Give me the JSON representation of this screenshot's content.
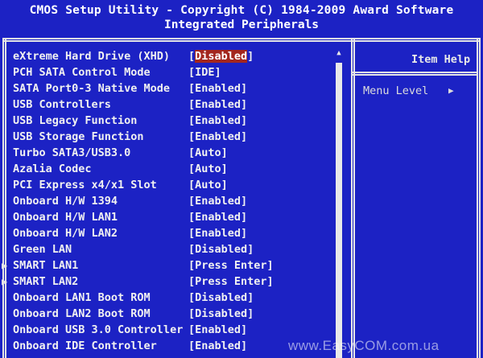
{
  "header": {
    "title": "CMOS Setup Utility - Copyright (C) 1984-2009 Award Software",
    "subtitle": "Integrated Peripherals"
  },
  "help_panel": {
    "title": "Item Help",
    "menu_level_label": "Menu Level",
    "menu_level_arrow": "▶"
  },
  "scrollbar": {
    "up_arrow": "▲"
  },
  "items": [
    {
      "label": "eXtreme Hard Drive (XHD)",
      "value_prefix": "[",
      "value": "Disabled",
      "value_suffix": "]",
      "selected": true,
      "submenu": false
    },
    {
      "label": "PCH SATA Control Mode",
      "value_prefix": "[",
      "value": "IDE",
      "value_suffix": "]",
      "selected": false,
      "submenu": false
    },
    {
      "label": "SATA Port0-3 Native Mode",
      "value_prefix": "[",
      "value": "Enabled",
      "value_suffix": "]",
      "selected": false,
      "submenu": false
    },
    {
      "label": "USB Controllers",
      "value_prefix": "[",
      "value": "Enabled",
      "value_suffix": "]",
      "selected": false,
      "submenu": false
    },
    {
      "label": "USB Legacy Function",
      "value_prefix": "[",
      "value": "Enabled",
      "value_suffix": "]",
      "selected": false,
      "submenu": false
    },
    {
      "label": "USB Storage Function",
      "value_prefix": "[",
      "value": "Enabled",
      "value_suffix": "]",
      "selected": false,
      "submenu": false
    },
    {
      "label": "Turbo SATA3/USB3.0",
      "value_prefix": "[",
      "value": "Auto",
      "value_suffix": "]",
      "selected": false,
      "submenu": false
    },
    {
      "label": "Azalia Codec",
      "value_prefix": "[",
      "value": "Auto",
      "value_suffix": "]",
      "selected": false,
      "submenu": false
    },
    {
      "label": "PCI Express x4/x1 Slot",
      "value_prefix": "[",
      "value": "Auto",
      "value_suffix": "]",
      "selected": false,
      "submenu": false
    },
    {
      "label": "Onboard H/W 1394",
      "value_prefix": "[",
      "value": "Enabled",
      "value_suffix": "]",
      "selected": false,
      "submenu": false
    },
    {
      "label": "Onboard H/W LAN1",
      "value_prefix": "[",
      "value": "Enabled",
      "value_suffix": "]",
      "selected": false,
      "submenu": false
    },
    {
      "label": "Onboard H/W LAN2",
      "value_prefix": "[",
      "value": "Enabled",
      "value_suffix": "]",
      "selected": false,
      "submenu": false
    },
    {
      "label": "Green LAN",
      "value_prefix": "[",
      "value": "Disabled",
      "value_suffix": "]",
      "selected": false,
      "submenu": false
    },
    {
      "label": "SMART LAN1",
      "value_prefix": "[",
      "value": "Press Enter",
      "value_suffix": "]",
      "selected": false,
      "submenu": true
    },
    {
      "label": "SMART LAN2",
      "value_prefix": "[",
      "value": "Press Enter",
      "value_suffix": "]",
      "selected": false,
      "submenu": true
    },
    {
      "label": "Onboard LAN1 Boot ROM",
      "value_prefix": "[",
      "value": "Disabled",
      "value_suffix": "]",
      "selected": false,
      "submenu": false
    },
    {
      "label": "Onboard LAN2 Boot ROM",
      "value_prefix": "[",
      "value": "Disabled",
      "value_suffix": "]",
      "selected": false,
      "submenu": false
    },
    {
      "label": "Onboard USB 3.0 Controller",
      "value_prefix": "[",
      "value": "Enabled",
      "value_suffix": "]",
      "selected": false,
      "submenu": false
    },
    {
      "label": "Onboard IDE Controller",
      "value_prefix": "[",
      "value": "Enabled",
      "value_suffix": "]",
      "selected": false,
      "submenu": false
    }
  ],
  "submenu_arrow": "▶",
  "watermark": "www.EasyCOM.com.ua",
  "colors": {
    "background": "#1c22c4",
    "text": "#f1f1f1",
    "selection_bg": "#a3271e",
    "frame": "#e6e6e6"
  }
}
